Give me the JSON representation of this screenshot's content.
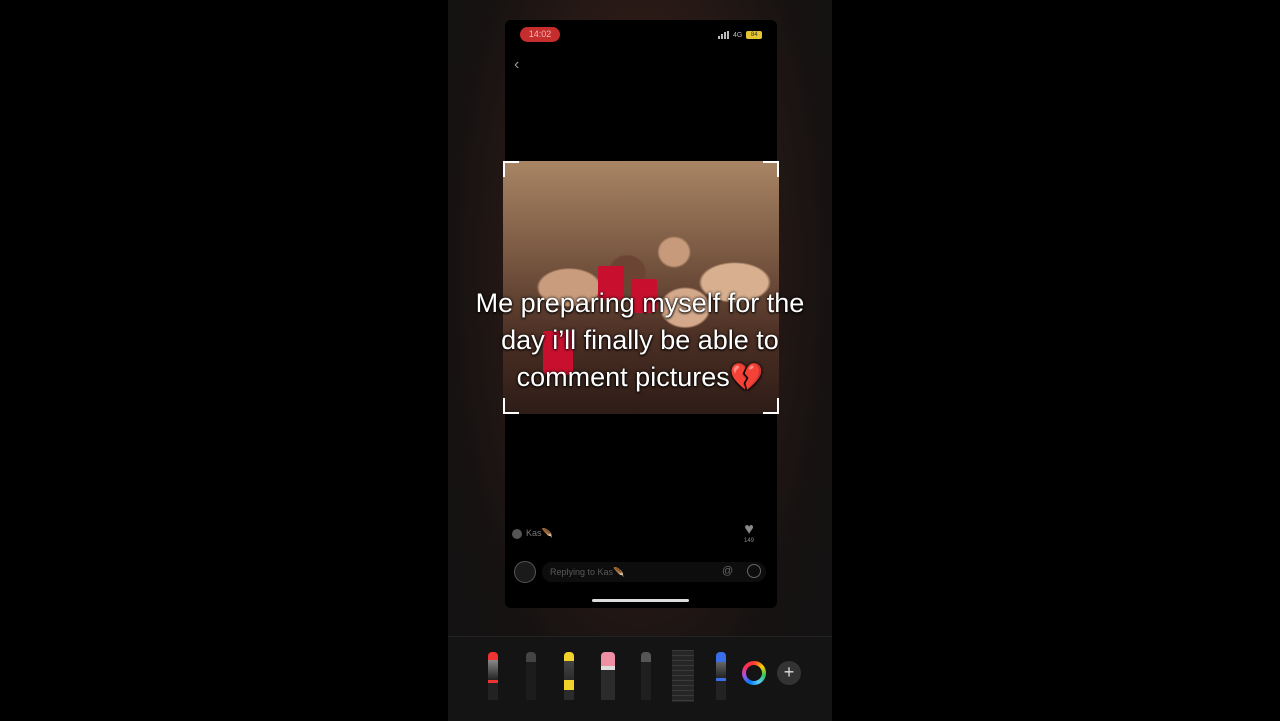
{
  "status_bar": {
    "time": "14:02",
    "network": "4G",
    "battery": "84"
  },
  "post": {
    "caption": "Me preparing myself for the day i’ll finally be able to comment pictures💔",
    "author": "Kas🪶",
    "likes": "149"
  },
  "reply": {
    "placeholder": "Replying to Kas🪶"
  },
  "icons": {
    "back": "chevron-left-icon",
    "heart": "heart-icon",
    "mention": "at-icon",
    "emoji": "emoji-icon",
    "add": "plus-icon"
  },
  "markup_tools": [
    "pen",
    "marker",
    "highlighter",
    "eraser",
    "pencil",
    "ruler",
    "blue-pen",
    "color-picker"
  ],
  "colors": {
    "status_time_bg": "#c62d2d",
    "battery": "#e5c531",
    "highlighter": "#f1d22a",
    "eraser": "#ef8fa3",
    "blue_pen": "#3a6ee8"
  }
}
